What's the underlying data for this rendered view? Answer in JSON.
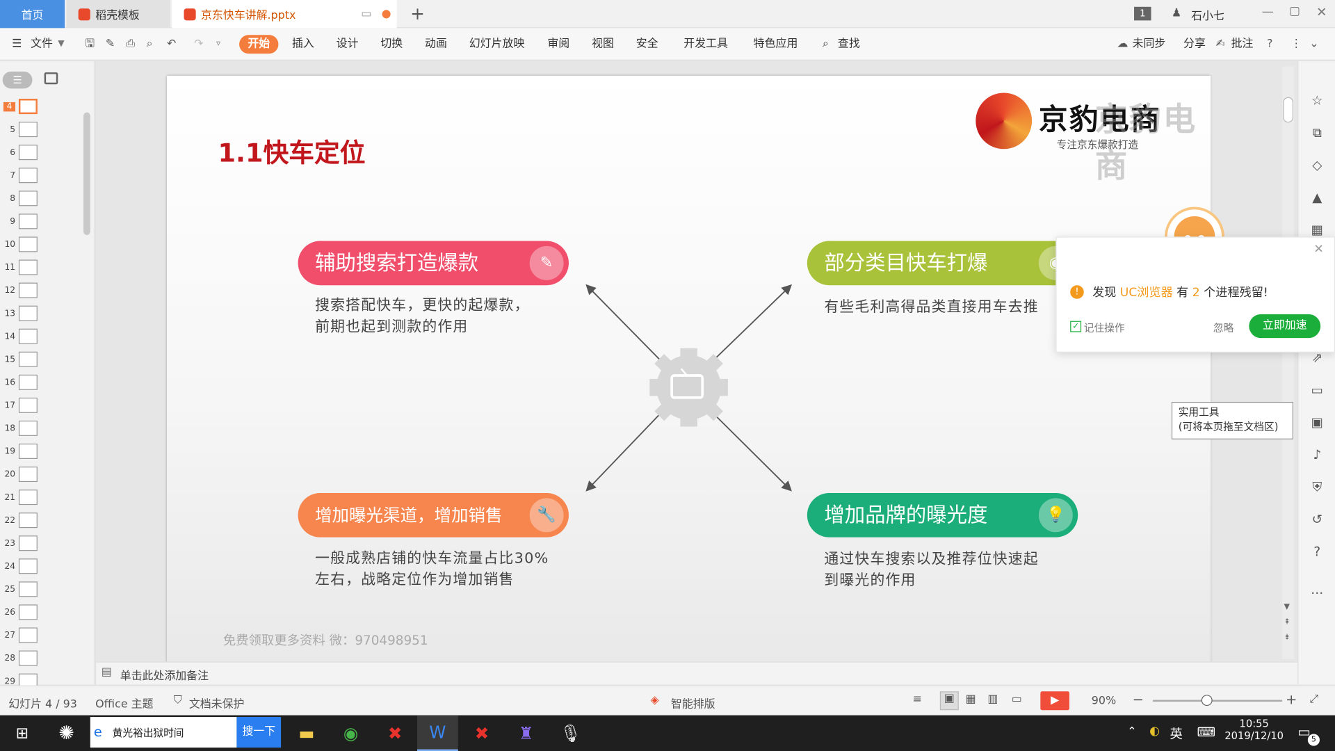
{
  "tabs": {
    "home": "首页",
    "daoke": "稻壳模板",
    "doc": "京东快车讲解.pptx"
  },
  "window": {
    "badge": "1",
    "user": "石小七"
  },
  "menu": {
    "file": "文件",
    "items": [
      "开始",
      "插入",
      "设计",
      "切换",
      "动画",
      "幻灯片放映",
      "审阅",
      "视图",
      "安全",
      "开发工具",
      "特色应用"
    ],
    "search": "查找",
    "sync": "未同步",
    "share": "分享",
    "comment": "批注"
  },
  "thumbs": [
    "4",
    "5",
    "6",
    "7",
    "8",
    "9",
    "10",
    "11",
    "12",
    "13",
    "14",
    "15",
    "16",
    "17",
    "18",
    "19",
    "20",
    "21",
    "22",
    "23",
    "24",
    "25",
    "26",
    "27",
    "28",
    "29"
  ],
  "slide": {
    "title": "1.1快车定位",
    "logo_text": "京豹电商",
    "logo_sub": "专注京东爆款打造",
    "cards": [
      {
        "title": "辅助搜索打造爆款",
        "body": [
          "搜索搭配快车，更快的起爆款，",
          "前期也起到测款的作用"
        ],
        "color": "#f04e6a",
        "icon": "pen-icon"
      },
      {
        "title": "部分类目快车打爆",
        "body": [
          "有些毛利高得品类直接用车去推"
        ],
        "color": "#a8c23a",
        "icon": "camera-icon"
      },
      {
        "title": "增加曝光渠道，增加销售",
        "body": [
          "一般成熟店铺的快车流量占比30%",
          "左右，战略定位作为增加销售"
        ],
        "color": "#f6854e",
        "icon": "wrench-icon"
      },
      {
        "title": "增加品牌的曝光度",
        "body": [
          "通过快车搜索以及推荐位快速起",
          "到曝光的作用"
        ],
        "color": "#1bae7a",
        "icon": "bulb-icon"
      }
    ],
    "footer": "免费领取更多资料 微：970498951"
  },
  "popup": {
    "msg_pre": "发现",
    "msg_app": "UC浏览器",
    "msg_mid": "有",
    "msg_num": "2",
    "msg_post": "个进程残留!",
    "remember": "记住操作",
    "ignore": "忽略",
    "accel": "立即加速"
  },
  "tooltip": {
    "line1": "实用工具",
    "line2": "(可将本页拖至文档区)"
  },
  "notes": {
    "placeholder": "单击此处添加备注"
  },
  "status": {
    "slide": "幻灯片 4 / 93",
    "theme": "Office 主题",
    "protect": "文档未保护",
    "smart": "智能排版",
    "zoom": "90%"
  },
  "taskbar": {
    "search_text": "黄光裕出狱时间",
    "search_btn": "搜一下",
    "ime": "英",
    "time": "10:55",
    "date": "2019/12/10",
    "notif": "5"
  }
}
